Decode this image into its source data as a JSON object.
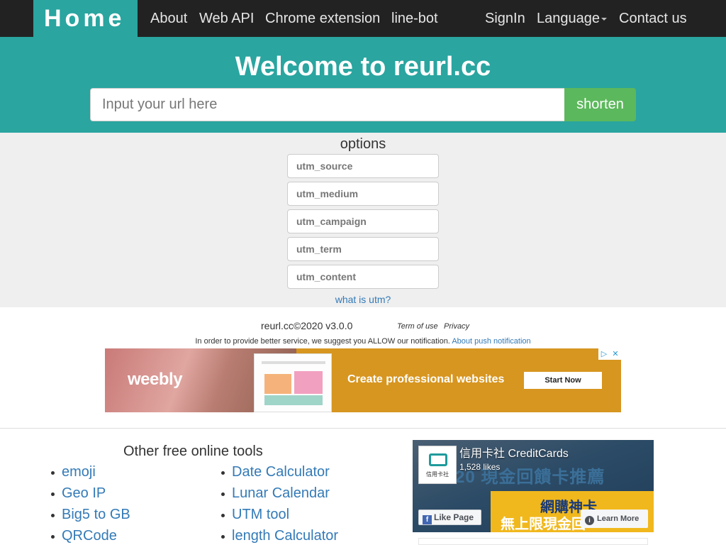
{
  "nav": {
    "brand": "Home",
    "links": [
      "About",
      "Web API",
      "Chrome extension",
      "line-bot"
    ],
    "signin": "SignIn",
    "language": "Language",
    "contact": "Contact us"
  },
  "hero": {
    "title": "Welcome to reurl.cc",
    "url_placeholder": "Input your url here",
    "shorten_label": "shorten"
  },
  "options": {
    "title": "options",
    "fields": [
      "utm_source",
      "utm_medium",
      "utm_campaign",
      "utm_term",
      "utm_content"
    ],
    "help_link": "what is utm?"
  },
  "footer": {
    "copyright": "reurl.cc©2020 v3.0.0",
    "term": "Term of use",
    "privacy": "Privacy",
    "notice": "In order to provide better service, we suggest you ALLOW our notification.",
    "notice_link": "About push notification"
  },
  "ad": {
    "brand": "weebly",
    "headline": "Create professional websites",
    "cta": "Start Now",
    "choice_icon": "▷",
    "close_icon": "✕",
    "color": "#d79620"
  },
  "tools": {
    "title": "Other free online tools",
    "col1": [
      "emoji",
      "Geo IP",
      "Big5 to GB",
      "QRCode"
    ],
    "col2": [
      "Date Calculator",
      "Lunar Calendar",
      "UTM tool",
      "length Calculator"
    ]
  },
  "facebook": {
    "page_name": "信用卡社 CreditCards",
    "likes": "1,528 likes",
    "logo_text": "信用卡社",
    "cover_line1": "20 現金回饋卡推薦",
    "cover_line2": "網購神卡",
    "cover_line3": "無上限現金回",
    "like_button": "Like Page",
    "learn_button": "Learn More"
  },
  "colors": {
    "navbar": "#222222",
    "teal": "#2aa5a0",
    "shorten": "#5cb85c",
    "link": "#337ab7",
    "options_bg": "#efefef"
  }
}
